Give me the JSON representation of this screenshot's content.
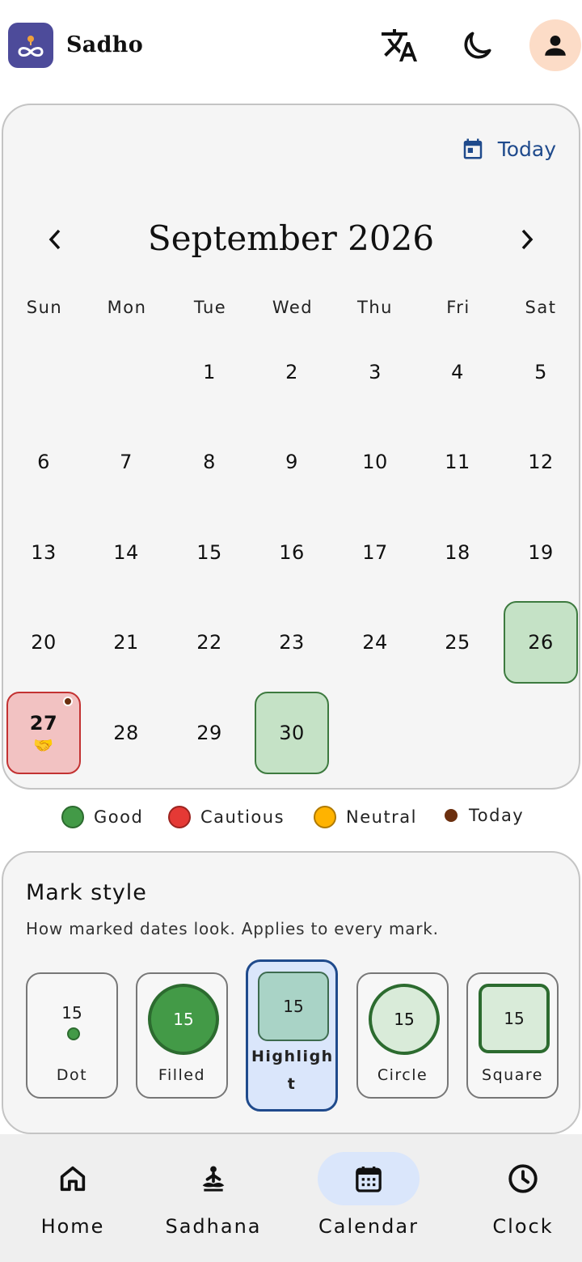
{
  "app": {
    "title": "Sadho"
  },
  "header": {
    "icons": [
      "translate-icon",
      "moon-icon",
      "person-icon"
    ],
    "profile_bg": "#fcdcc7",
    "logo_bg": "#4d4b9a"
  },
  "calendar": {
    "today_label": "Today",
    "month_title": "September 2026",
    "weekdays": [
      "Sun",
      "Mon",
      "Tue",
      "Wed",
      "Thu",
      "Fri",
      "Sat"
    ],
    "days": [
      {
        "label": "1"
      },
      {
        "label": "2"
      },
      {
        "label": "3"
      },
      {
        "label": "4"
      },
      {
        "label": "5"
      },
      {
        "label": "6"
      },
      {
        "label": "7"
      },
      {
        "label": "8"
      },
      {
        "label": "9"
      },
      {
        "label": "10"
      },
      {
        "label": "11"
      },
      {
        "label": "12"
      },
      {
        "label": "13"
      },
      {
        "label": "14"
      },
      {
        "label": "15"
      },
      {
        "label": "16"
      },
      {
        "label": "17"
      },
      {
        "label": "18"
      },
      {
        "label": "19"
      },
      {
        "label": "20"
      },
      {
        "label": "21"
      },
      {
        "label": "22"
      },
      {
        "label": "23"
      },
      {
        "label": "24"
      },
      {
        "label": "25"
      },
      {
        "label": "26",
        "mark": "good"
      },
      {
        "label": "27",
        "mark": "cautious",
        "today": true,
        "emoji": "🤝"
      },
      {
        "label": "28"
      },
      {
        "label": "29"
      },
      {
        "label": "30",
        "mark": "good"
      }
    ],
    "colors": {
      "good": "#c5e2c6",
      "cautious": "#f2c2c2",
      "accent": "#1f4a8c"
    }
  },
  "legend": {
    "good": "Good",
    "cautious": "Cautious",
    "neutral": "Neutral",
    "today": "Today",
    "colors": {
      "good": "#439a47",
      "cautious": "#e53935",
      "neutral": "#ffb300",
      "today": "#6b2f0f"
    }
  },
  "mark_style": {
    "title": "Mark style",
    "subtitle": "How marked dates look. Applies to every mark.",
    "sample_day": "15",
    "options": {
      "dot": "Dot",
      "filled": "Filled",
      "highlight": "Highligh t",
      "circle": "Circle",
      "square": "Square"
    },
    "selected": "highlight"
  },
  "nav": {
    "home": "Home",
    "sadhana": "Sadhana",
    "calendar": "Calendar",
    "clock": "Clock",
    "active": "calendar"
  }
}
